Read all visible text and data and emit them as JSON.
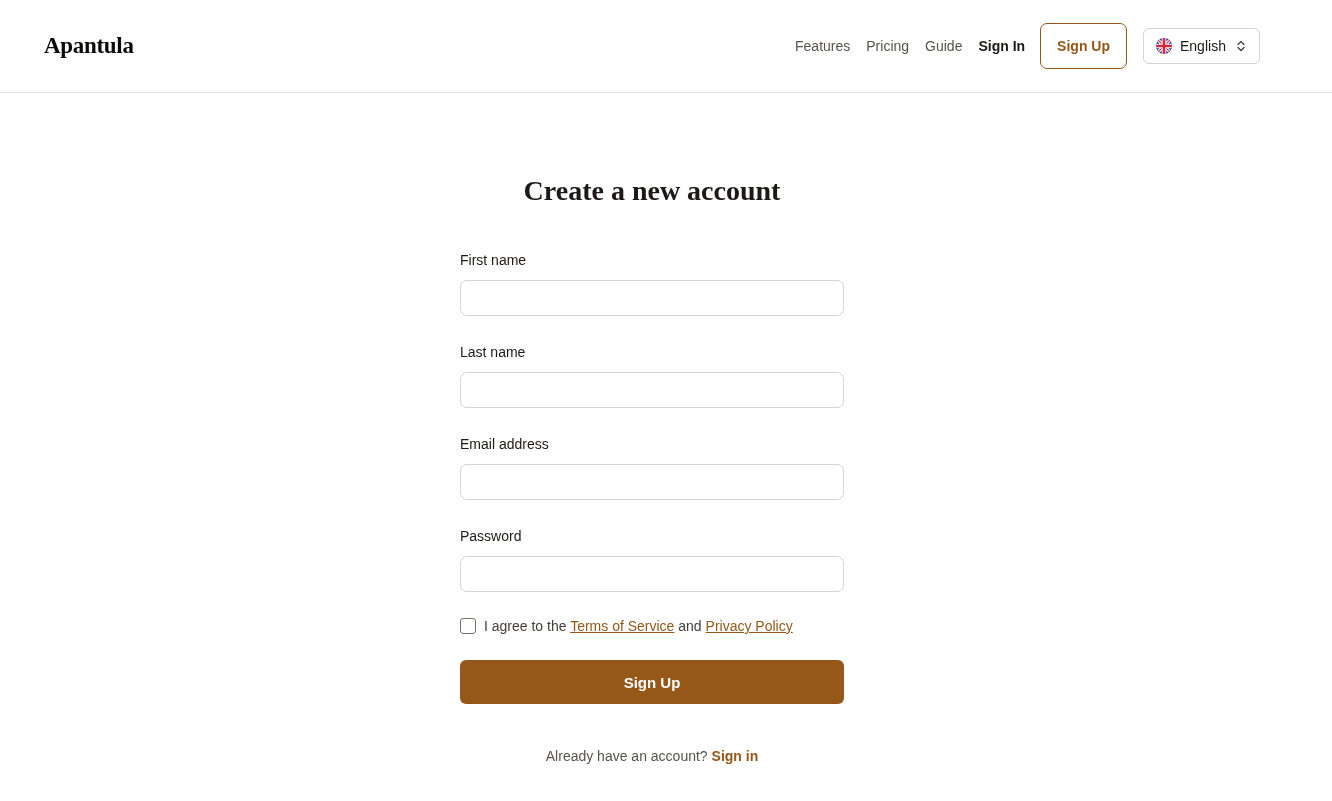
{
  "header": {
    "logo": "Apantula",
    "nav": [
      {
        "label": "Features",
        "kind": "plain"
      },
      {
        "label": "Pricing",
        "kind": "plain"
      },
      {
        "label": "Guide",
        "kind": "plain"
      },
      {
        "label": "Sign In",
        "kind": "strong"
      }
    ],
    "signup_button": "Sign Up",
    "language_select": {
      "value": "English"
    }
  },
  "form": {
    "title": "Create a new account",
    "fields": [
      {
        "label": "First name"
      },
      {
        "label": "Last name"
      },
      {
        "label": "Email address"
      },
      {
        "label": "Password"
      }
    ],
    "agreement": {
      "checked": false,
      "segments": [
        {
          "kind": "text",
          "text": "I agree to the"
        },
        {
          "kind": "link",
          "text": "Terms of Service"
        },
        {
          "kind": "text",
          "text": "and"
        },
        {
          "kind": "link",
          "text": "Privacy Policy"
        }
      ]
    },
    "submit_button": "Sign Up",
    "footer": {
      "text": "Already have an account?",
      "link": "Sign in"
    }
  }
}
